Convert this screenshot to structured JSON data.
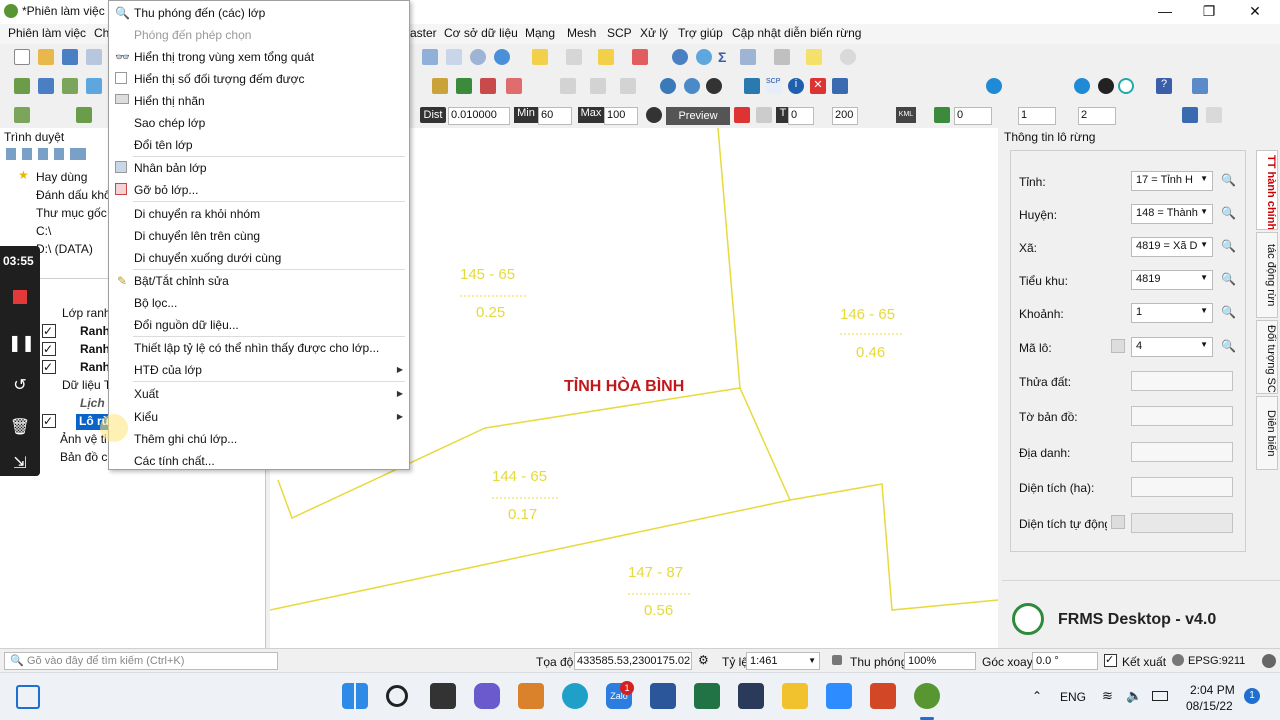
{
  "window": {
    "title": "*Phiên làm việc k",
    "minimize": "—",
    "restore": "❐",
    "close": "✕"
  },
  "menubar": {
    "items_left": [
      "Phiên làm việc",
      "Ch"
    ],
    "items_right": [
      "aster",
      "Cơ sở dữ liệu",
      "Mạng",
      "Mesh",
      "SCP",
      "Xử lý",
      "Trợ giúp",
      "Cập nhật diễn biến rừng"
    ]
  },
  "label_toolbar": {
    "dist_label": "Dist",
    "dist_value": "0.010000",
    "min_label": "Min",
    "min_value": "60",
    "max_label": "Max",
    "max_value": "100",
    "preview_label": "Preview",
    "t_label": "T",
    "t_value": "0",
    "s_value": "200",
    "spin1": "0",
    "spin2": "1",
    "spin3": "2",
    "kml_label": "KML"
  },
  "browser_panel": {
    "title": "Trình duyệt",
    "items": [
      "Hay dùng",
      "Đánh dấu khô",
      "Thư mục gốc",
      "C:\\",
      "D:\\ (DATA)"
    ]
  },
  "layers_panel": {
    "items": [
      {
        "label": "Lớp ranh",
        "bold": false
      },
      {
        "label": "Ranh",
        "bold": true
      },
      {
        "label": "Ranh",
        "bold": true
      },
      {
        "label": "Ranh",
        "bold": true
      },
      {
        "label": "Dữ liệu T",
        "bold": false
      },
      {
        "label": "Lịch s",
        "bold": false
      },
      {
        "label": "Lô rừ",
        "bold": false
      },
      {
        "label": "Ảnh vệ ti",
        "bold": false
      },
      {
        "label": "Bản đồ c",
        "bold": false
      }
    ]
  },
  "context_menu": {
    "items": [
      {
        "label": "Thu phóng đến (các) lớp",
        "disabled": false,
        "icon": "zoom-icon"
      },
      {
        "label": "Phóng đến phép chọn",
        "disabled": true,
        "icon": "zoom-selection-icon"
      },
      {
        "label": "Hiển thị trong vùng xem tổng quát",
        "disabled": false,
        "icon": "glasses-icon"
      },
      {
        "label": "Hiển thị số đối tượng đếm được",
        "disabled": false,
        "icon": "checkbox-icon"
      },
      {
        "label": "Hiển thị nhãn",
        "disabled": false,
        "icon": "label-icon"
      },
      {
        "label": "Sao chép lớp",
        "disabled": false,
        "icon": ""
      },
      {
        "label": "Đổi tên lớp",
        "disabled": false,
        "icon": ""
      },
      {
        "label": "Nhân bản lớp",
        "disabled": false,
        "icon": "duplicate-icon"
      },
      {
        "label": "Gỡ bỏ lớp...",
        "disabled": false,
        "icon": "remove-icon"
      },
      {
        "label": "Di chuyển ra khỏi nhóm",
        "disabled": false,
        "icon": ""
      },
      {
        "label": "Di chuyển lên trên cùng",
        "disabled": false,
        "icon": ""
      },
      {
        "label": "Di chuyển xuống dưới cùng",
        "disabled": false,
        "icon": ""
      },
      {
        "label": "Bật/Tắt chỉnh sửa",
        "disabled": false,
        "icon": "pencil-icon"
      },
      {
        "label": "Bộ lọc...",
        "disabled": false,
        "icon": ""
      },
      {
        "label": "Đổi nguồn dữ liệu...",
        "disabled": false,
        "icon": ""
      },
      {
        "label": "Thiết lập tỷ lệ có thể nhìn thấy được cho lớp...",
        "disabled": false,
        "icon": ""
      },
      {
        "label": "HTĐ của lớp",
        "disabled": false,
        "icon": ""
      },
      {
        "label": "Xuất",
        "disabled": false,
        "icon": ""
      },
      {
        "label": "Kiểu",
        "disabled": false,
        "icon": ""
      },
      {
        "label": "Thêm ghi chú lớp...",
        "disabled": false,
        "icon": ""
      },
      {
        "label": "Các tính chất...",
        "disabled": false,
        "icon": ""
      }
    ]
  },
  "map": {
    "province_label": "TỈNH HÒA BÌNH",
    "parcels": [
      {
        "top": "145  -  65",
        "bottom": "0.25"
      },
      {
        "top": "146  -  65",
        "bottom": "0.46"
      },
      {
        "top": "144  -  65",
        "bottom": "0.17"
      },
      {
        "top": "147  -  87",
        "bottom": "0.56"
      }
    ]
  },
  "right_panel": {
    "title": "Thông tin lô rừng",
    "fields": [
      {
        "label": "Tỉnh:",
        "value": "17 = Tỉnh H",
        "type": "combo"
      },
      {
        "label": "Huyện:",
        "value": "148 = Thành",
        "type": "combo"
      },
      {
        "label": "Xã:",
        "value": "4819 = Xã D",
        "type": "combo"
      },
      {
        "label": "Tiểu khu:",
        "value": "4819",
        "type": "combo"
      },
      {
        "label": "Khoảnh:",
        "value": "1",
        "type": "combo"
      },
      {
        "label": "Mã lô:",
        "value": "4",
        "type": "combo"
      },
      {
        "label": "Thửa đất:",
        "value": "",
        "type": "text"
      },
      {
        "label": "Tờ bản đồ:",
        "value": "",
        "type": "text"
      },
      {
        "label": "Địa danh:",
        "value": "",
        "type": "text"
      },
      {
        "label": "Diện tích (ha):",
        "value": "",
        "type": "text"
      },
      {
        "label": "Diện tích tự động t",
        "value": "",
        "type": "text"
      }
    ],
    "tabs": [
      "TT hành chính",
      "tác động rừn",
      "Đối tượng SC",
      "Diễn biến"
    ],
    "app_name": "FRMS Desktop - v4.0"
  },
  "statusbar": {
    "search_placeholder": "Gõ vào đây để tìm kiếm (Ctrl+K)",
    "coord_label": "Tọa độ",
    "coord_value": "433585.53,2300175.02",
    "scale_label": "Tỷ lệ",
    "scale_value": "1:461",
    "zoom_label": "Thu phóng",
    "zoom_value": "100%",
    "rotation_label": "Góc xoay",
    "rotation_value": "0.0 °",
    "render_label": "Kết xuất",
    "crs_label": "EPSG:9211"
  },
  "recorder": {
    "time": "03:55"
  },
  "taskbar": {
    "lang": "ENG",
    "time": "2:04 PM",
    "date": "08/15/22",
    "notif_count": "1",
    "zalo_badge": "1",
    "zalo_label": "Zalo"
  },
  "colors": {
    "map_lines": "#e8d93c",
    "province_label": "#c0181b",
    "selection": "#0a63c9"
  }
}
